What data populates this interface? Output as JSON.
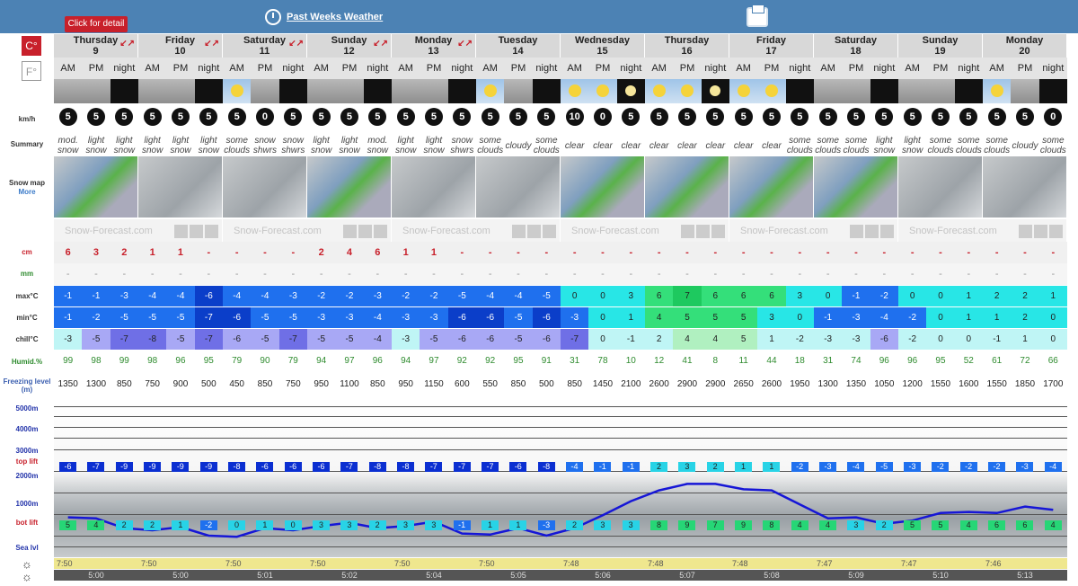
{
  "header": {
    "detail_label": "Click for detail",
    "past_weeks_label": "Past Weeks Weather"
  },
  "units": {
    "c": "C°",
    "f": "F°"
  },
  "row_labels": {
    "wind": "km/h",
    "summary": "Summary",
    "snow_map": "Snow map",
    "more": "More",
    "snow": "cm",
    "rain": "mm",
    "max": "max°C",
    "min": "min°C",
    "chill": "chill°C",
    "humid": "Humid.%",
    "freezing": "Freezing level (m)",
    "alt5000": "5000m",
    "alt4000": "4000m",
    "alt3000": "3000m",
    "alt2000": "2000m",
    "alt1000": "1000m",
    "top_lift": "top lift",
    "bot_lift": "bot lift",
    "sea_lvl": "Sea lvl"
  },
  "map_footer": "Snow-Forecast.com",
  "periods": [
    "AM",
    "PM",
    "night"
  ],
  "days": [
    {
      "name": "Thursday",
      "num": "9",
      "hint": "↙↗"
    },
    {
      "name": "Friday",
      "num": "10",
      "hint": "↙↗"
    },
    {
      "name": "Saturday",
      "num": "11",
      "hint": "↙↗"
    },
    {
      "name": "Sunday",
      "num": "12",
      "hint": "↙↗"
    },
    {
      "name": "Monday",
      "num": "13",
      "hint": "↙↗"
    },
    {
      "name": "Tuesday",
      "num": "14",
      "hint": ""
    },
    {
      "name": "Wednesday",
      "num": "15",
      "hint": ""
    },
    {
      "name": "Thursday",
      "num": "16",
      "hint": ""
    },
    {
      "name": "Friday",
      "num": "17",
      "hint": ""
    },
    {
      "name": "Saturday",
      "num": "18",
      "hint": ""
    },
    {
      "name": "Sunday",
      "num": "19",
      "hint": ""
    },
    {
      "name": "Monday",
      "num": "20",
      "hint": ""
    }
  ],
  "icons": [
    "snow",
    "snow",
    "night-snow",
    "snow",
    "snow",
    "night-snow",
    "partly-sunny",
    "snow",
    "night-cloud",
    "snow",
    "snow",
    "night-snow",
    "snow",
    "snow",
    "night-snow",
    "partly-sunny",
    "cloudy",
    "night-cloud",
    "sunny",
    "sunny",
    "night-clear",
    "sunny",
    "sunny",
    "night-clear",
    "sunny",
    "partly-sunny",
    "night-cloud",
    "cloudy",
    "snow",
    "night-snow",
    "cloudy",
    "cloudy",
    "night-cloud",
    "partly-sunny",
    "cloudy",
    "night-cloud"
  ],
  "wind": [
    "5",
    "5",
    "5",
    "5",
    "5",
    "5",
    "5",
    "0",
    "5",
    "5",
    "5",
    "5",
    "5",
    "5",
    "5",
    "5",
    "5",
    "5",
    "10",
    "0",
    "5",
    "5",
    "5",
    "5",
    "5",
    "5",
    "5",
    "5",
    "5",
    "5",
    "5",
    "5",
    "5",
    "5",
    "5",
    "0"
  ],
  "summary": [
    "mod. snow",
    "light snow",
    "light snow",
    "light snow",
    "light snow",
    "light snow",
    "some clouds",
    "snow shwrs",
    "snow shwrs",
    "light snow",
    "light snow",
    "mod. snow",
    "light snow",
    "light snow",
    "snow shwrs",
    "some clouds",
    "cloudy",
    "some clouds",
    "clear",
    "clear",
    "clear",
    "clear",
    "clear",
    "clear",
    "clear",
    "clear",
    "some clouds",
    "some clouds",
    "some clouds",
    "light snow",
    "light snow",
    "some clouds",
    "some clouds",
    "some clouds",
    "cloudy",
    "some clouds"
  ],
  "snow": [
    "6",
    "3",
    "2",
    "1",
    "1",
    "-",
    "-",
    "-",
    "-",
    "2",
    "4",
    "6",
    "1",
    "1",
    "-",
    "-",
    "-",
    "-",
    "-",
    "-",
    "-",
    "-",
    "-",
    "-",
    "-",
    "-",
    "-",
    "-",
    "-",
    "-",
    "-",
    "-",
    "-",
    "-",
    "-",
    "-"
  ],
  "rain": [
    "-",
    "-",
    "-",
    "-",
    "-",
    "-",
    "-",
    "-",
    "-",
    "-",
    "-",
    "-",
    "-",
    "-",
    "-",
    "-",
    "-",
    "-",
    "-",
    "-",
    "-",
    "-",
    "-",
    "-",
    "-",
    "-",
    "-",
    "-",
    "-",
    "-",
    "-",
    "-",
    "-",
    "-",
    "-",
    "-"
  ],
  "max": [
    "-1",
    "-1",
    "-3",
    "-4",
    "-4",
    "-6",
    "-4",
    "-4",
    "-3",
    "-2",
    "-2",
    "-3",
    "-2",
    "-2",
    "-5",
    "-4",
    "-4",
    "-5",
    "0",
    "0",
    "3",
    "6",
    "7",
    "6",
    "6",
    "6",
    "3",
    "0",
    "-1",
    "-2",
    "0",
    "0",
    "1",
    "2",
    "2",
    "1"
  ],
  "min": [
    "-1",
    "-2",
    "-5",
    "-5",
    "-5",
    "-7",
    "-6",
    "-5",
    "-5",
    "-3",
    "-3",
    "-4",
    "-3",
    "-3",
    "-6",
    "-6",
    "-5",
    "-6",
    "-3",
    "0",
    "1",
    "4",
    "5",
    "5",
    "5",
    "3",
    "0",
    "-1",
    "-3",
    "-4",
    "-2",
    "0",
    "1",
    "1",
    "2",
    "0"
  ],
  "chill": [
    "-3",
    "-5",
    "-7",
    "-8",
    "-5",
    "-7",
    "-6",
    "-5",
    "-7",
    "-5",
    "-5",
    "-4",
    "-3",
    "-5",
    "-6",
    "-6",
    "-5",
    "-6",
    "-7",
    "0",
    "-1",
    "2",
    "4",
    "4",
    "5",
    "1",
    "-2",
    "-3",
    "-3",
    "-6",
    "-2",
    "0",
    "0",
    "-1",
    "1",
    "0"
  ],
  "humid": [
    "99",
    "98",
    "99",
    "98",
    "96",
    "95",
    "79",
    "90",
    "79",
    "94",
    "97",
    "96",
    "94",
    "97",
    "92",
    "92",
    "95",
    "91",
    "31",
    "78",
    "10",
    "12",
    "41",
    "8",
    "11",
    "44",
    "18",
    "31",
    "74",
    "96",
    "96",
    "95",
    "52",
    "61",
    "72",
    "66"
  ],
  "freezing": [
    "1350",
    "1300",
    "850",
    "750",
    "900",
    "500",
    "450",
    "850",
    "750",
    "950",
    "1100",
    "850",
    "950",
    "1150",
    "600",
    "550",
    "850",
    "500",
    "850",
    "1450",
    "2100",
    "2600",
    "2900",
    "2900",
    "2650",
    "2600",
    "1950",
    "1300",
    "1350",
    "1050",
    "1200",
    "1550",
    "1600",
    "1550",
    "1850",
    "1700"
  ],
  "top_lift": [
    "-6",
    "-7",
    "-9",
    "-9",
    "-9",
    "-9",
    "-8",
    "-6",
    "-6",
    "-6",
    "-7",
    "-8",
    "-8",
    "-7",
    "-7",
    "-7",
    "-6",
    "-8",
    "-4",
    "-1",
    "-1",
    "2",
    "3",
    "2",
    "1",
    "1",
    "-2",
    "-3",
    "-4",
    "-5",
    "-3",
    "-2",
    "-2",
    "-2",
    "-3",
    "-4"
  ],
  "bot_lift": [
    "5",
    "4",
    "2",
    "2",
    "1",
    "-2",
    "0",
    "1",
    "0",
    "3",
    "3",
    "2",
    "3",
    "3",
    "-1",
    "1",
    "1",
    "-3",
    "2",
    "3",
    "3",
    "8",
    "9",
    "7",
    "9",
    "8",
    "4",
    "4",
    "3",
    "2",
    "5",
    "5",
    "4",
    "6",
    "6",
    "4"
  ],
  "sunrise": [
    "7:50",
    "7:50",
    "7:50",
    "7:50",
    "7:50",
    "7:50",
    "7:48",
    "7:48",
    "7:48",
    "7:47",
    "7:47",
    "7:46"
  ],
  "sunset": [
    "5:00",
    "5:00",
    "5:01",
    "5:02",
    "5:04",
    "5:05",
    "5:06",
    "5:07",
    "5:08",
    "5:09",
    "5:10",
    "5:13"
  ],
  "colors": {
    "top_bar": "#4c82b4",
    "detail": "#c8202b",
    "line": "#1616d6"
  }
}
